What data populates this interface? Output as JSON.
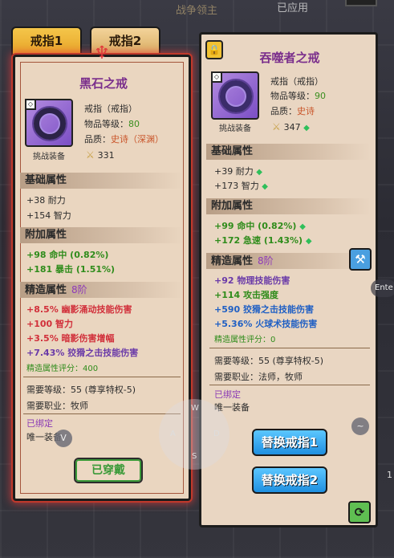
{
  "top": {
    "banner": "战争领主",
    "applied": "已应用"
  },
  "tabs": [
    {
      "label": "戒指1"
    },
    {
      "label": "戒指2"
    }
  ],
  "left": {
    "title": "黑石之戒",
    "type": "戒指（戒指）",
    "level_label": "物品等级：",
    "level_value": "80",
    "quality_label": "品质：",
    "quality_value": "史诗（深渊）",
    "challenge": "挑战装备",
    "score": "331",
    "base_header": "基础属性",
    "base_stats": [
      "+38 耐力",
      "+154 智力"
    ],
    "extra_header": "附加属性",
    "extra_stats": [
      "+98 命中 (0.82%)",
      "+181 暴击 (1.51%)"
    ],
    "refine_header": "精造属性",
    "refine_level": "8阶",
    "refine_stats": [
      "+8.5% 幽影涌动技能伤害",
      "+100 智力",
      "+3.5% 暗影伤害增幅",
      "+7.43% 狡猾之击技能伤害"
    ],
    "refine_score": "精造属性评分：400",
    "req_level": "需要等级：55 (尊享特权-5)",
    "req_job": "需要职业：牧师",
    "bound": "已绑定",
    "unique": "唯一装备",
    "equipped_btn": "已穿戴"
  },
  "right": {
    "title": "吞噬者之戒",
    "type": "戒指（戒指）",
    "level_label": "物品等级：",
    "level_value": "90",
    "quality_label": "品质：",
    "quality_value": "史诗",
    "challenge": "挑战装备",
    "score": "347",
    "base_header": "基础属性",
    "base_stats": [
      "+39 耐力",
      "+173 智力"
    ],
    "extra_header": "附加属性",
    "extra_stats": [
      "+99 命中 (0.82%)",
      "+172 急速 (1.43%)"
    ],
    "refine_header": "精造属性",
    "refine_level": "8阶",
    "refine_stats": [
      "+92 物理技能伤害",
      "+114 攻击强度",
      "+590 狡猾之击技能伤害",
      "+5.36% 火球术技能伤害"
    ],
    "refine_score": "精造属性评分：0",
    "req_level": "需要等级：55 (尊享特权-5)",
    "req_job": "需要职业：法师，牧师",
    "bound": "已绑定",
    "unique": "唯一装备",
    "replace1": "替换戒指1",
    "replace2": "替换戒指2"
  },
  "joystick": {
    "w": "W",
    "a": "A",
    "s": "S",
    "d": "D"
  },
  "side": {
    "enter": "Ente",
    "page": "1",
    "tilde": "~",
    "v": "V"
  }
}
